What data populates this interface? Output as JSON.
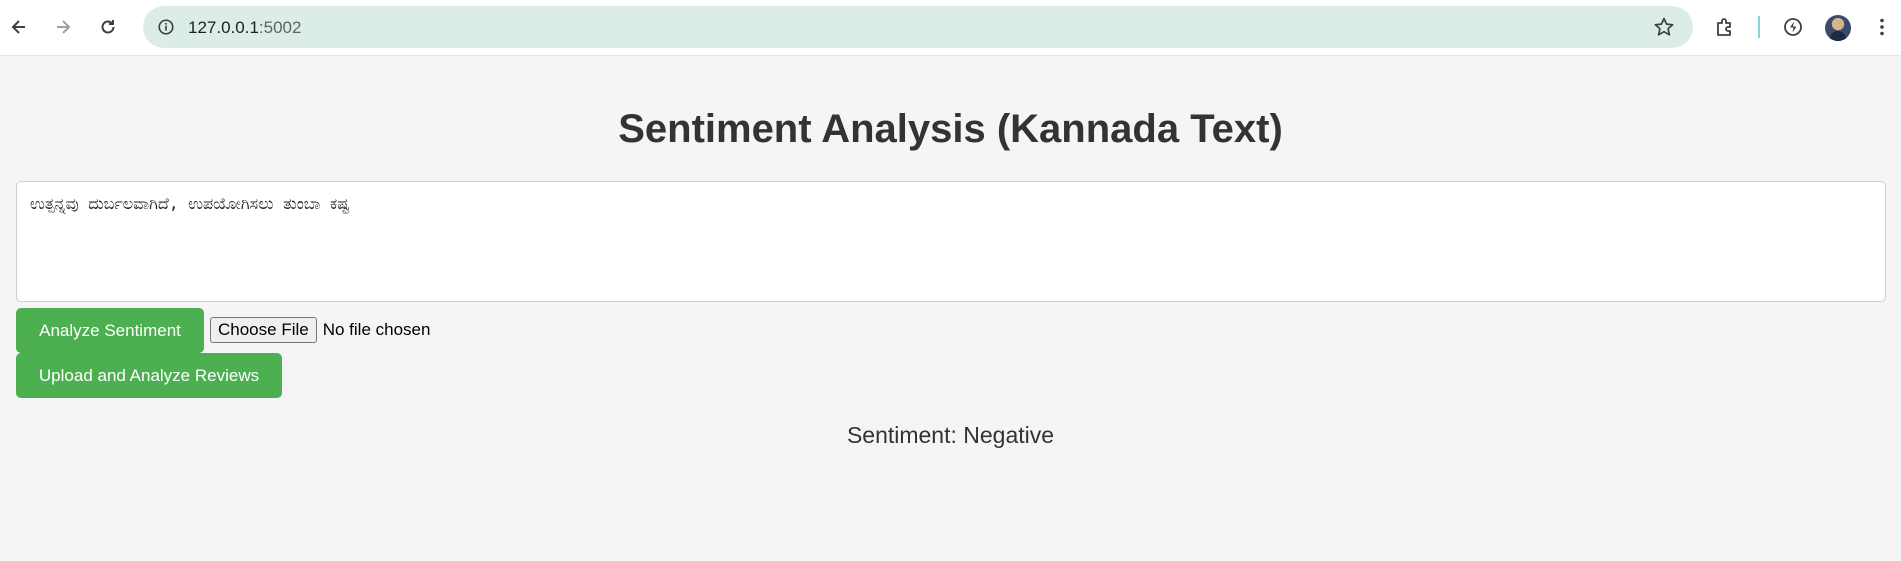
{
  "browser": {
    "url_host": "127.0.0.1",
    "url_port": ":5002",
    "icons": [
      "back-arrow-icon",
      "forward-arrow-icon",
      "reload-icon",
      "site-info-icon",
      "bookmark-star-icon",
      "extensions-icon",
      "performance-icon",
      "profile-avatar",
      "more-menu-icon"
    ]
  },
  "page": {
    "title": "Sentiment Analysis (Kannada Text)",
    "review_text": "ಉತ್ಪನ್ನವು ದುರ್ಬಲವಾಗಿದೆ, ಉಪಯೋಗಿಸಲು ತುಂಬಾ ಕಷ್ಟ",
    "analyze_button": "Analyze Sentiment",
    "choose_file_button": "Choose File",
    "file_status": "No file chosen",
    "upload_button": "Upload and Analyze Reviews",
    "result": "Sentiment: Negative"
  },
  "colors": {
    "button_green": "#4caf50",
    "omnibox": "#dcede8",
    "page_bg": "#f5f5f5"
  }
}
